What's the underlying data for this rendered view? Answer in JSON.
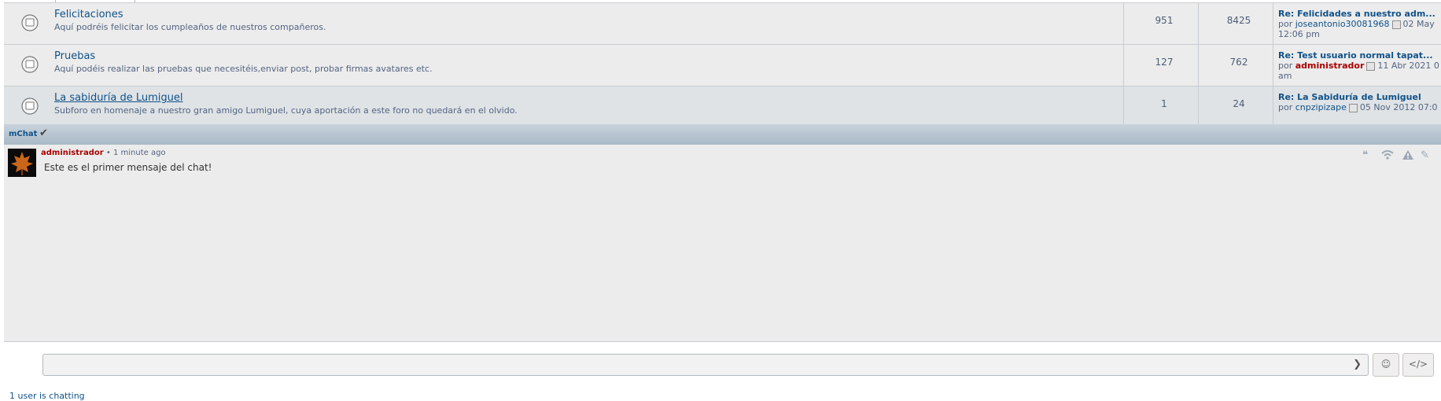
{
  "forums": [
    {
      "name": "Felicitaciones",
      "description": "Aquí podréis felicitar los cumpleaños de nuestros compañeros.",
      "topics": "951",
      "posts": "8425",
      "last_post": {
        "title": "Re: Felicidades a nuestro adm...",
        "by": "por",
        "user": "joseantonio30081968",
        "date": "02 May",
        "date2": "12:06 pm"
      }
    },
    {
      "name": "Pruebas",
      "description": "Aquí podéis realizar las pruebas que necesitéis,enviar post, probar firmas avatares etc.",
      "topics": "127",
      "posts": "762",
      "last_post": {
        "title": "Re: Test usuario normal tapat...",
        "by": "por",
        "user": "administrador",
        "date": "11 Abr 2021 0",
        "date2": "am"
      }
    },
    {
      "name": "La sabiduría de Lumiguel",
      "description": "Subforo en homenaje a nuestro gran amigo Lumiguel, cuya aportación a este foro no quedará en el olvido.",
      "topics": "1",
      "posts": "24",
      "last_post": {
        "title": "Re: La Sabiduría de Lumiguel",
        "by": "por",
        "user": "cnpzipizape",
        "date": "05 Nov 2012 07:0"
      }
    }
  ],
  "mchat": {
    "title": "mChat",
    "message": {
      "author": "administrador",
      "time": "• 1 minute ago",
      "text": "Este es el primer mensaje del chat!"
    },
    "input_placeholder": "",
    "status_count": "1",
    "status_text": "user is chatting"
  },
  "icons": {
    "forum": "forum-read-icon",
    "check": "check-icon",
    "quote": "quote-icon",
    "wifi": "ip-icon",
    "warn": "report-icon",
    "edit": "edit-icon",
    "submit": "chevron-right-icon",
    "smiley": "smiley-icon",
    "bbcode": "code-icon"
  },
  "colors": {
    "link": "#105289",
    "admin": "#aa0000",
    "row_bg": "#ececec",
    "row_hover": "#dfe3e6",
    "header": "#b6c4cf"
  }
}
